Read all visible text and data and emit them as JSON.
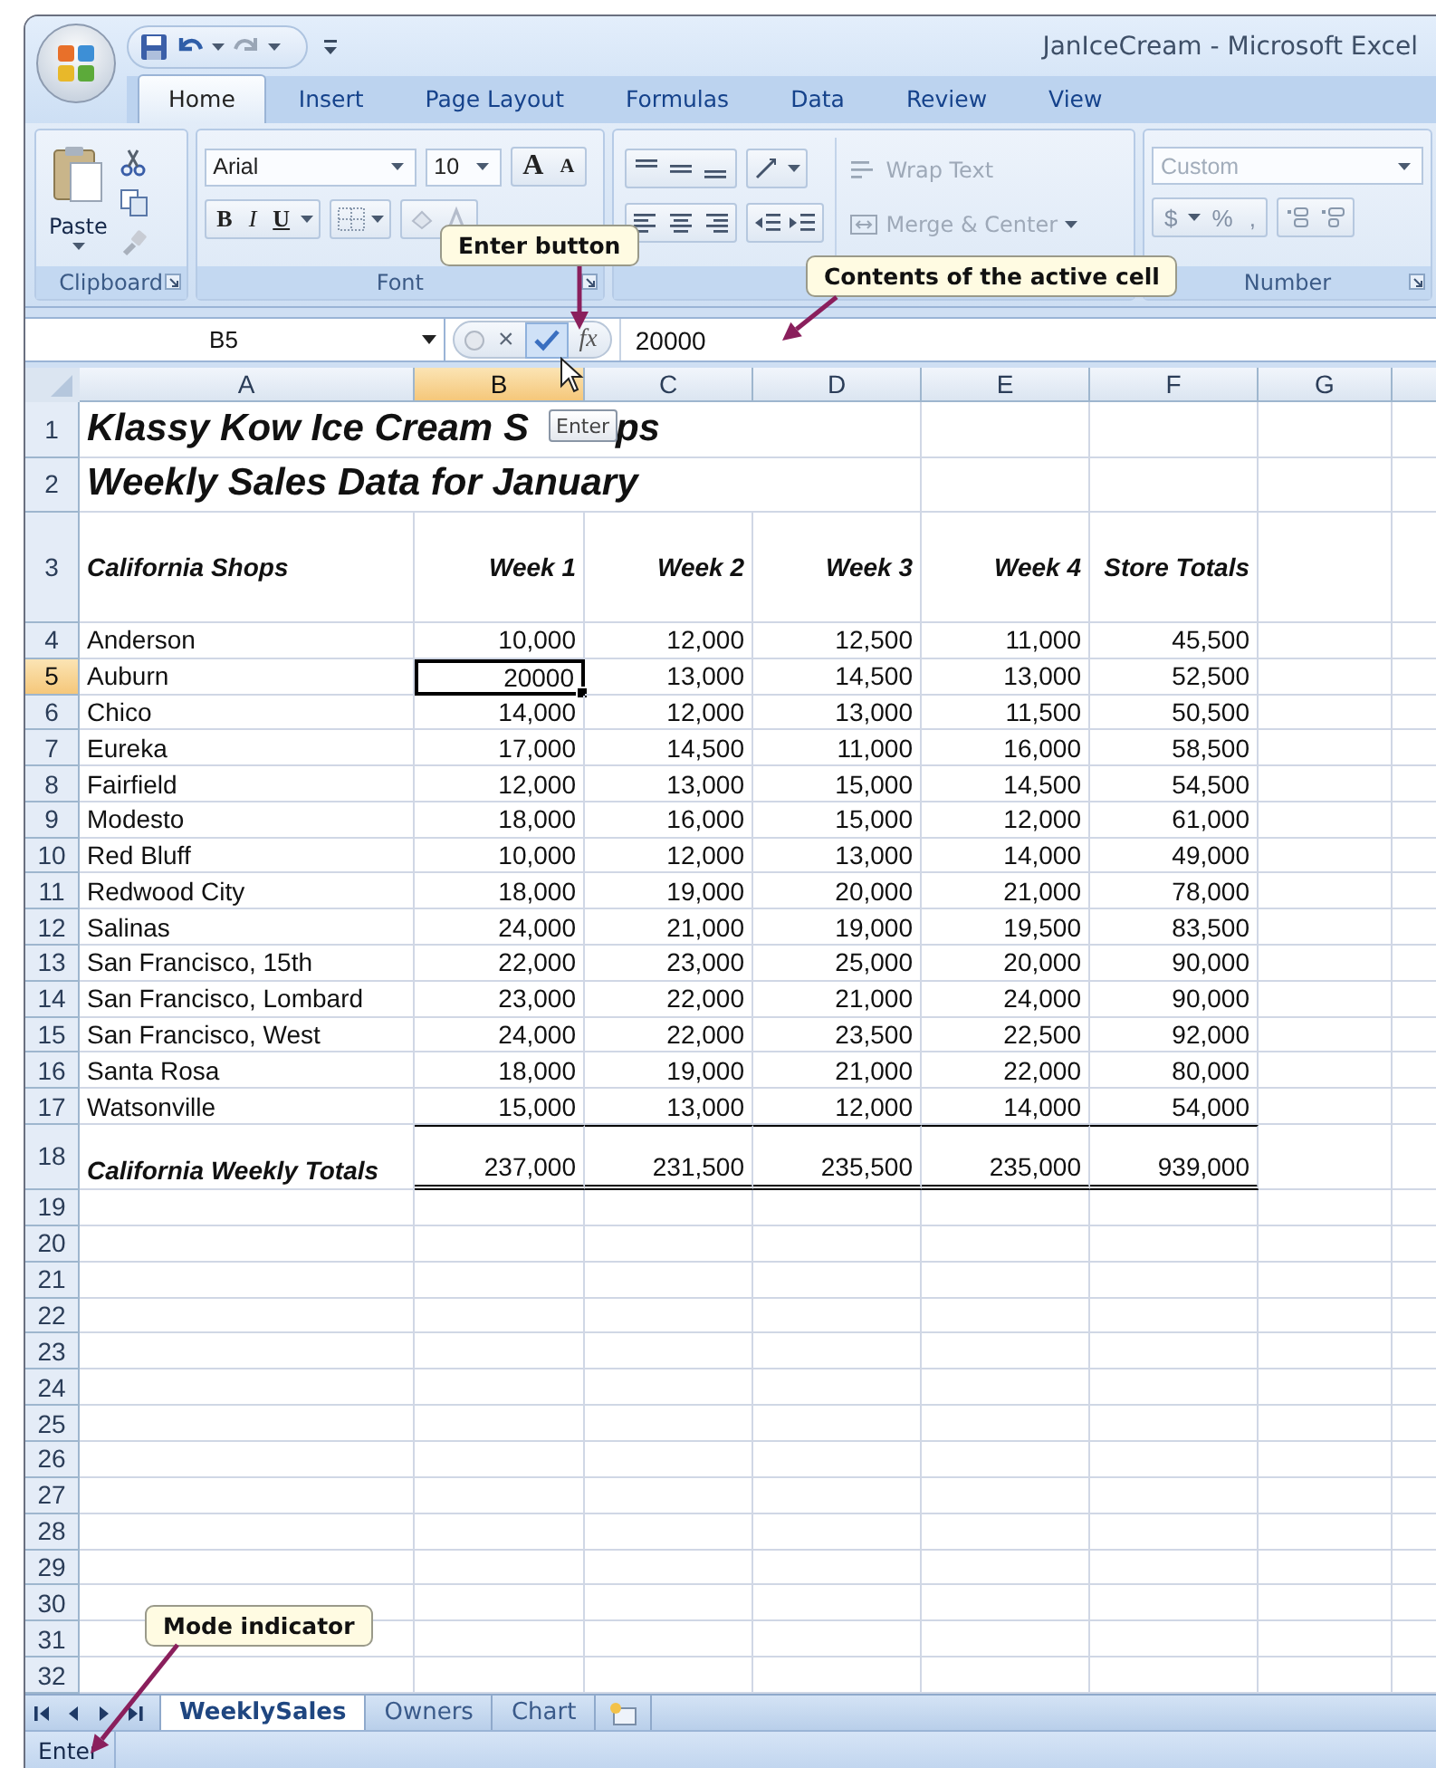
{
  "window": {
    "title": "JanIceCream - Microsoft Excel"
  },
  "tabs": [
    {
      "label": "Home",
      "selected": true
    },
    {
      "label": "Insert",
      "selected": false
    },
    {
      "label": "Page Layout",
      "selected": false
    },
    {
      "label": "Formulas",
      "selected": false
    },
    {
      "label": "Data",
      "selected": false
    },
    {
      "label": "Review",
      "selected": false
    },
    {
      "label": "View",
      "selected": false
    }
  ],
  "ribbon": {
    "clipboard": {
      "paste": "Paste",
      "label": "Clipboard"
    },
    "font": {
      "name": "Arial",
      "size": "10",
      "grow": "A",
      "shrink": "A",
      "bold": "B",
      "italic": "I",
      "underline": "U",
      "label": "Font"
    },
    "alignment": {
      "wrap_text": {
        "label": "Wrap Text",
        "disabled": true
      },
      "merge_center": {
        "label": "Merge & Center",
        "disabled": true
      }
    },
    "number": {
      "format": {
        "label": "Custom",
        "disabled": true
      },
      "currency": "$",
      "percent": "%",
      "comma": ",",
      "label": "Number"
    }
  },
  "formula_bar": {
    "name_box": "B5",
    "cancel": "×",
    "insert_function": "fx",
    "value": "20000",
    "enter_tooltip": "Enter"
  },
  "columns": [
    {
      "label": "A",
      "selected": false
    },
    {
      "label": "B",
      "selected": true
    },
    {
      "label": "C",
      "selected": false
    },
    {
      "label": "D",
      "selected": false
    },
    {
      "label": "E",
      "selected": false
    },
    {
      "label": "F",
      "selected": false
    },
    {
      "label": "G",
      "selected": false
    }
  ],
  "rows": [
    {
      "number": "1",
      "kind": "title",
      "selected": false,
      "cells": [
        [
          "Klassy Kow Ice Cream S",
          "ps"
        ]
      ]
    },
    {
      "number": "2",
      "kind": "title",
      "selected": false,
      "cells": [
        "Weekly Sales Data for January"
      ]
    },
    {
      "number": "3",
      "kind": "header",
      "selected": false,
      "cells": [
        "California Shops",
        "Week 1",
        "Week 2",
        "Week 3",
        "Week 4",
        "Store Totals"
      ]
    },
    {
      "number": "4",
      "kind": "data",
      "selected": false,
      "cells": [
        "Anderson",
        "10,000",
        "12,000",
        "12,500",
        "11,000",
        "45,500"
      ]
    },
    {
      "number": "5",
      "kind": "data",
      "selected": true,
      "cells": [
        "Auburn",
        "20000",
        "13,000",
        "14,500",
        "13,000",
        "52,500"
      ]
    },
    {
      "number": "6",
      "kind": "data",
      "selected": false,
      "cells": [
        "Chico",
        "14,000",
        "12,000",
        "13,000",
        "11,500",
        "50,500"
      ]
    },
    {
      "number": "7",
      "kind": "data",
      "selected": false,
      "cells": [
        "Eureka",
        "17,000",
        "14,500",
        "11,000",
        "16,000",
        "58,500"
      ]
    },
    {
      "number": "8",
      "kind": "data",
      "selected": false,
      "cells": [
        "Fairfield",
        "12,000",
        "13,000",
        "15,000",
        "14,500",
        "54,500"
      ]
    },
    {
      "number": "9",
      "kind": "data",
      "selected": false,
      "cells": [
        "Modesto",
        "18,000",
        "16,000",
        "15,000",
        "12,000",
        "61,000"
      ]
    },
    {
      "number": "10",
      "kind": "data",
      "selected": false,
      "cells": [
        "Red Bluff",
        "10,000",
        "12,000",
        "13,000",
        "14,000",
        "49,000"
      ]
    },
    {
      "number": "11",
      "kind": "data",
      "selected": false,
      "cells": [
        "Redwood City",
        "18,000",
        "19,000",
        "20,000",
        "21,000",
        "78,000"
      ]
    },
    {
      "number": "12",
      "kind": "data",
      "selected": false,
      "cells": [
        "Salinas",
        "24,000",
        "21,000",
        "19,000",
        "19,500",
        "83,500"
      ]
    },
    {
      "number": "13",
      "kind": "data",
      "selected": false,
      "cells": [
        "San Francisco, 15th",
        "22,000",
        "23,000",
        "25,000",
        "20,000",
        "90,000"
      ]
    },
    {
      "number": "14",
      "kind": "data",
      "selected": false,
      "cells": [
        "San Francisco, Lombard",
        "23,000",
        "22,000",
        "21,000",
        "24,000",
        "90,000"
      ]
    },
    {
      "number": "15",
      "kind": "data",
      "selected": false,
      "cells": [
        "San Francisco, West",
        "24,000",
        "22,000",
        "23,500",
        "22,500",
        "92,000"
      ]
    },
    {
      "number": "16",
      "kind": "data",
      "selected": false,
      "cells": [
        "Santa Rosa",
        "18,000",
        "19,000",
        "21,000",
        "22,000",
        "80,000"
      ]
    },
    {
      "number": "17",
      "kind": "data",
      "selected": false,
      "cells": [
        "Watsonville",
        "15,000",
        "13,000",
        "12,000",
        "14,000",
        "54,000"
      ]
    },
    {
      "number": "18",
      "kind": "total",
      "selected": false,
      "cells": [
        "California Weekly Totals",
        "237,000",
        "231,500",
        "235,500",
        "235,000",
        "939,000"
      ]
    },
    {
      "number": "19",
      "kind": "empty",
      "selected": false
    },
    {
      "number": "20",
      "kind": "empty",
      "selected": false
    },
    {
      "number": "21",
      "kind": "empty",
      "selected": false
    },
    {
      "number": "22",
      "kind": "empty",
      "selected": false
    },
    {
      "number": "23",
      "kind": "empty",
      "selected": false
    },
    {
      "number": "24",
      "kind": "empty",
      "selected": false
    },
    {
      "number": "25",
      "kind": "empty",
      "selected": false
    },
    {
      "number": "26",
      "kind": "empty",
      "selected": false
    },
    {
      "number": "27",
      "kind": "empty",
      "selected": false
    },
    {
      "number": "28",
      "kind": "empty",
      "selected": false
    },
    {
      "number": "29",
      "kind": "empty",
      "selected": false
    },
    {
      "number": "30",
      "kind": "empty",
      "selected": false
    },
    {
      "number": "31",
      "kind": "empty",
      "selected": false
    },
    {
      "number": "32",
      "kind": "empty",
      "selected": false
    }
  ],
  "sheet_tabs": [
    {
      "label": "WeeklySales",
      "selected": true
    },
    {
      "label": "Owners",
      "selected": false
    },
    {
      "label": "Chart",
      "selected": false
    }
  ],
  "status_bar": {
    "mode": "Enter"
  },
  "callouts": [
    {
      "text": "Enter button"
    },
    {
      "text": "Contents of the active cell"
    },
    {
      "text": "Mode indicator"
    }
  ]
}
